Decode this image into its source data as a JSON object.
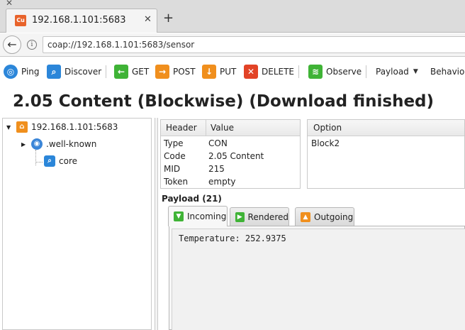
{
  "browser": {
    "tab_title": "192.168.1.101:5683",
    "tab_favicon_text": "Cu",
    "url": "coap://192.168.1.101:5683/sensor"
  },
  "toolbar": {
    "ping": "Ping",
    "discover": "Discover",
    "get": "GET",
    "post": "POST",
    "put": "PUT",
    "delete": "DELETE",
    "observe": "Observe",
    "payload": "Payload",
    "behavior": "Behavior"
  },
  "status_title": "2.05 Content (Blockwise) (Download finished)",
  "tree": {
    "root": "192.168.1.101:5683",
    "child": ".well-known",
    "leaf": "core"
  },
  "header_table": {
    "columns": [
      "Header",
      "Value"
    ],
    "rows": [
      {
        "name": "Type",
        "value": "CON"
      },
      {
        "name": "Code",
        "value": "2.05 Content"
      },
      {
        "name": "MID",
        "value": "215"
      },
      {
        "name": "Token",
        "value": "empty"
      }
    ]
  },
  "option_table": {
    "column": "Option",
    "rows": [
      "Block2"
    ]
  },
  "payload": {
    "label": "Payload (21)",
    "tabs": [
      "Incoming",
      "Rendered",
      "Outgoing"
    ],
    "active_tab": "Incoming",
    "content": "Temperature: 252.9375"
  },
  "colors": {
    "get_green": "#3fb336",
    "post_orange": "#f08f1d",
    "delete_red": "#e24326",
    "discover_blue": "#2b86d9"
  }
}
